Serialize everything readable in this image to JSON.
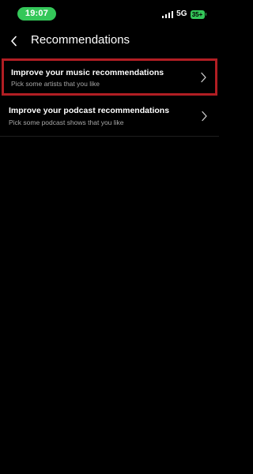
{
  "status_bar": {
    "time": "19:07",
    "network": "5G",
    "battery": "35+",
    "icons": [
      "signal-icon",
      "battery-icon"
    ],
    "time_pill_color": "#34c759",
    "battery_color": "#34c759"
  },
  "header": {
    "title": "Recommendations",
    "back_icon": "chevron-left-icon"
  },
  "list": {
    "items": [
      {
        "title": "Improve your music recommendations",
        "subtitle": "Pick some artists that you like",
        "highlighted": true,
        "icon": "chevron-right-icon"
      },
      {
        "title": "Improve your podcast recommendations",
        "subtitle": "Pick some podcast shows that you like",
        "highlighted": false,
        "icon": "chevron-right-icon"
      }
    ]
  },
  "colors": {
    "background": "#000000",
    "text_primary": "#ffffff",
    "text_secondary": "#a7a7a7",
    "highlight_border": "#b11e23"
  }
}
